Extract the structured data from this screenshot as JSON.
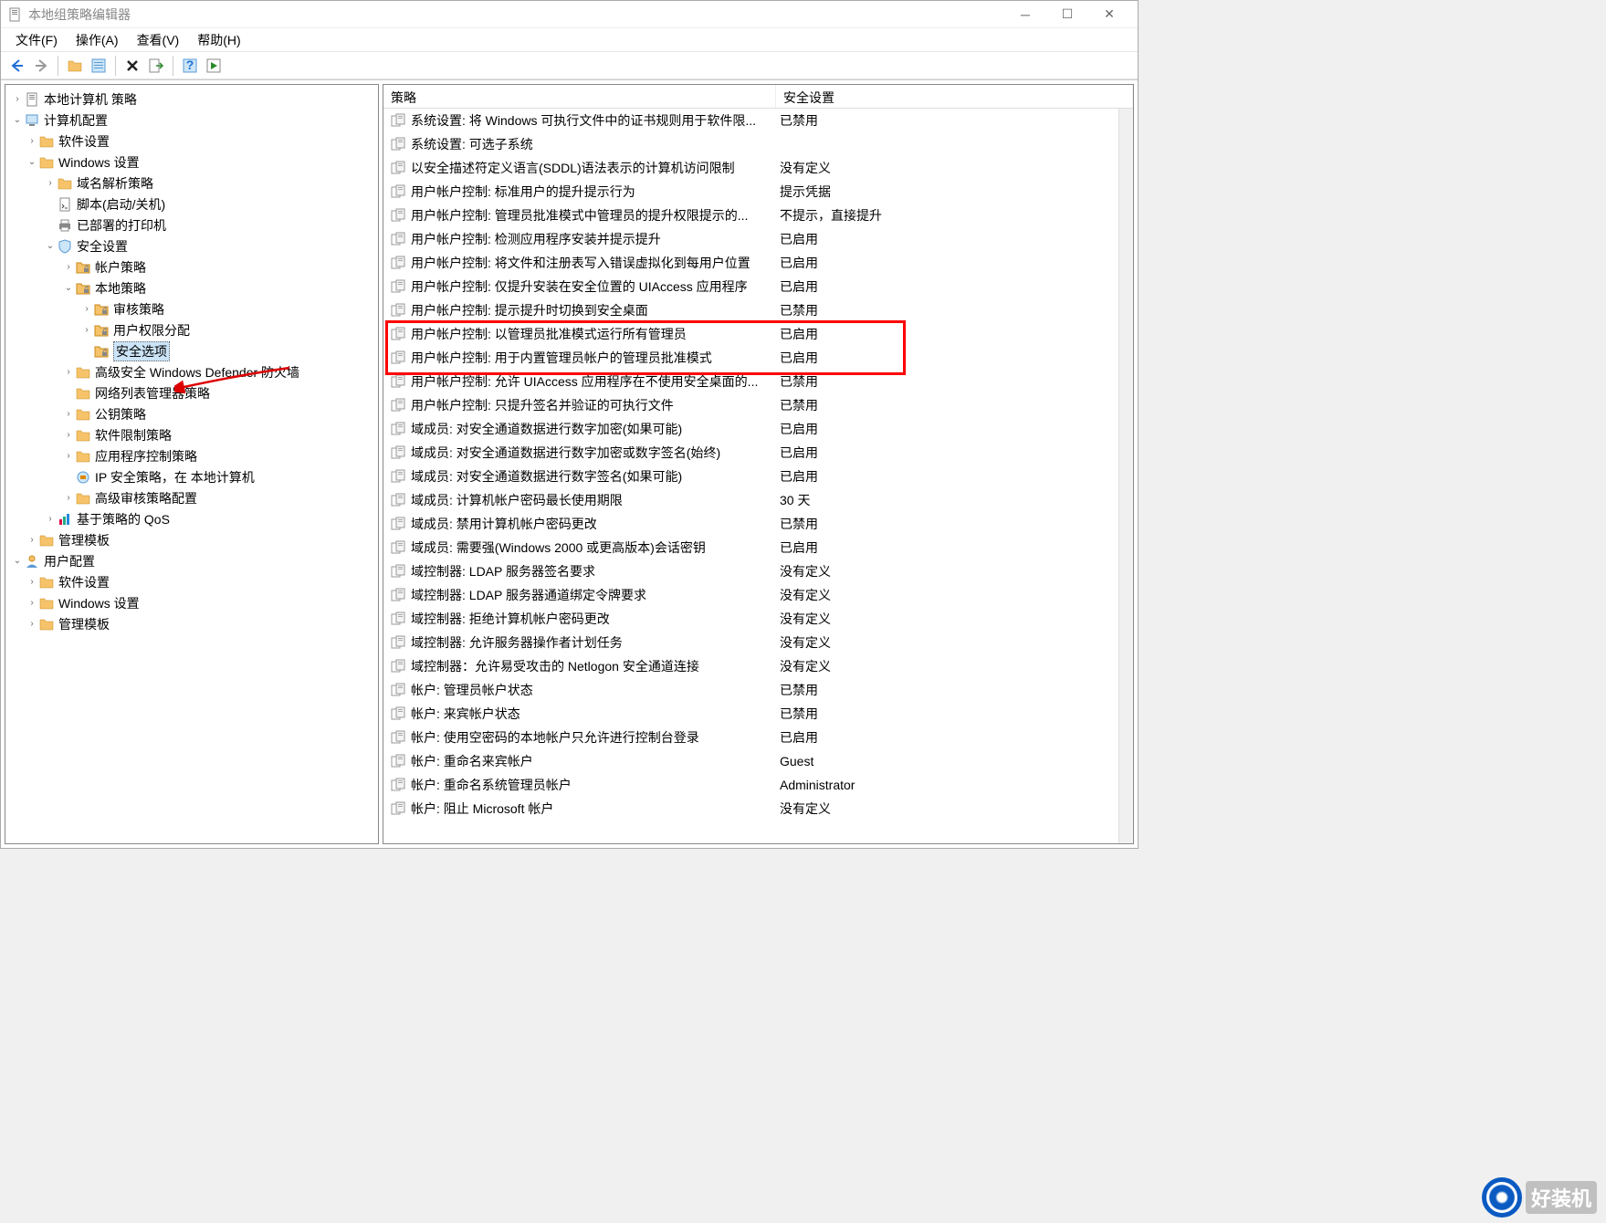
{
  "window": {
    "title": "本地组策略编辑器"
  },
  "menu": {
    "file": "文件(F)",
    "action": "操作(A)",
    "view": "查看(V)",
    "help": "帮助(H)"
  },
  "tree": {
    "root": "本地计算机 策略",
    "computer_config": "计算机配置",
    "software_settings": "软件设置",
    "windows_settings": "Windows 设置",
    "dns_policy": "域名解析策略",
    "scripts": "脚本(启动/关机)",
    "deployed_printers": "已部署的打印机",
    "security_settings": "安全设置",
    "account_policies": "帐户策略",
    "local_policies": "本地策略",
    "audit_policy": "审核策略",
    "user_rights": "用户权限分配",
    "security_options": "安全选项",
    "defender_firewall": "高级安全 Windows Defender 防火墙",
    "network_list": "网络列表管理器策略",
    "public_key": "公钥策略",
    "software_restriction": "软件限制策略",
    "app_control": "应用程序控制策略",
    "ip_security": "IP 安全策略，在 本地计算机",
    "advanced_audit": "高级审核策略配置",
    "policy_qos": "基于策略的 QoS",
    "admin_templates": "管理模板",
    "user_config": "用户配置",
    "software_settings2": "软件设置",
    "windows_settings2": "Windows 设置",
    "admin_templates2": "管理模板"
  },
  "columns": {
    "policy": "策略",
    "security_setting": "安全设置"
  },
  "policies": [
    {
      "name": "系统设置: 将 Windows 可执行文件中的证书规则用于软件限...",
      "setting": "已禁用"
    },
    {
      "name": "系统设置: 可选子系统",
      "setting": ""
    },
    {
      "name": "以安全描述符定义语言(SDDL)语法表示的计算机访问限制",
      "setting": "没有定义"
    },
    {
      "name": "用户帐户控制: 标准用户的提升提示行为",
      "setting": "提示凭据"
    },
    {
      "name": "用户帐户控制: 管理员批准模式中管理员的提升权限提示的...",
      "setting": "不提示，直接提升"
    },
    {
      "name": "用户帐户控制: 检测应用程序安装并提示提升",
      "setting": "已启用"
    },
    {
      "name": "用户帐户控制: 将文件和注册表写入错误虚拟化到每用户位置",
      "setting": "已启用"
    },
    {
      "name": "用户帐户控制: 仅提升安装在安全位置的 UIAccess 应用程序",
      "setting": "已启用"
    },
    {
      "name": "用户帐户控制: 提示提升时切换到安全桌面",
      "setting": "已禁用"
    },
    {
      "name": "用户帐户控制: 以管理员批准模式运行所有管理员",
      "setting": "已启用"
    },
    {
      "name": "用户帐户控制: 用于内置管理员帐户的管理员批准模式",
      "setting": "已启用"
    },
    {
      "name": "用户帐户控制: 允许 UIAccess 应用程序在不使用安全桌面的...",
      "setting": "已禁用"
    },
    {
      "name": "用户帐户控制: 只提升签名并验证的可执行文件",
      "setting": "已禁用"
    },
    {
      "name": "域成员: 对安全通道数据进行数字加密(如果可能)",
      "setting": "已启用"
    },
    {
      "name": "域成员: 对安全通道数据进行数字加密或数字签名(始终)",
      "setting": "已启用"
    },
    {
      "name": "域成员: 对安全通道数据进行数字签名(如果可能)",
      "setting": "已启用"
    },
    {
      "name": "域成员: 计算机帐户密码最长使用期限",
      "setting": "30 天"
    },
    {
      "name": "域成员: 禁用计算机帐户密码更改",
      "setting": "已禁用"
    },
    {
      "name": "域成员: 需要强(Windows 2000 或更高版本)会话密钥",
      "setting": "已启用"
    },
    {
      "name": "域控制器: LDAP 服务器签名要求",
      "setting": "没有定义"
    },
    {
      "name": "域控制器: LDAP 服务器通道绑定令牌要求",
      "setting": "没有定义"
    },
    {
      "name": "域控制器: 拒绝计算机帐户密码更改",
      "setting": "没有定义"
    },
    {
      "name": "域控制器: 允许服务器操作者计划任务",
      "setting": "没有定义"
    },
    {
      "name": "域控制器：允许易受攻击的 Netlogon 安全通道连接",
      "setting": "没有定义"
    },
    {
      "name": "帐户: 管理员帐户状态",
      "setting": "已禁用"
    },
    {
      "name": "帐户: 来宾帐户状态",
      "setting": "已禁用"
    },
    {
      "name": "帐户: 使用空密码的本地帐户只允许进行控制台登录",
      "setting": "已启用"
    },
    {
      "name": "帐户: 重命名来宾帐户",
      "setting": "Guest"
    },
    {
      "name": "帐户: 重命名系统管理员帐户",
      "setting": "Administrator"
    },
    {
      "name": "帐户: 阻止 Microsoft 帐户",
      "setting": "没有定义"
    }
  ],
  "logo_text": "好装机"
}
